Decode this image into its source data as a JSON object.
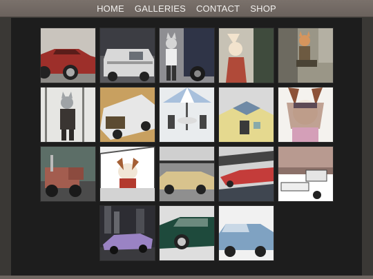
{
  "nav": {
    "items": [
      {
        "label": "HOME"
      },
      {
        "label": "GALLERIES"
      },
      {
        "label": "CONTACT"
      },
      {
        "label": "SHOP"
      }
    ]
  },
  "gallery": {
    "rows": [
      [
        "red-classic-car",
        "white-van-street",
        "cat-figure-by-truck",
        "fox-in-red-jacket",
        "fox-sitting-in-city"
      ],
      [
        "cat-in-snowy-forest",
        "white-truck-with-cargo",
        "patio-umbrella-table",
        "isometric-building",
        "fox-girl-with-goggles"
      ],
      [
        "red-semi-truck",
        "dog-driving-car",
        "tan-sedan-at-station",
        "red-car-on-street",
        "white-pickup-truck"
      ],
      [
        "purple-sports-car",
        "green-sedan",
        "blue-pickup-truck"
      ]
    ]
  },
  "colors": {
    "nav_bar": "#6f6762",
    "page_bg": "#3a3835",
    "panel_bg": "#1d1d1d",
    "nav_text": "#f2f0ee"
  }
}
